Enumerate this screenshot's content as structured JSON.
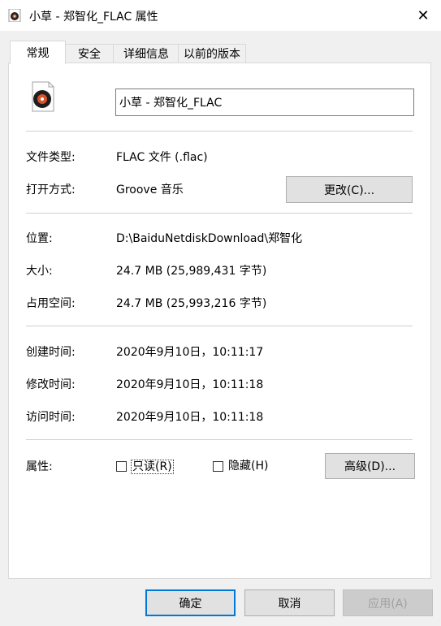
{
  "window": {
    "title": "小草 - 郑智化_FLAC 属性",
    "close_glyph": "✕"
  },
  "tabs": [
    {
      "label": "常规"
    },
    {
      "label": "安全"
    },
    {
      "label": "详细信息"
    },
    {
      "label": "以前的版本"
    }
  ],
  "general": {
    "file_name": "小草 - 郑智化_FLAC",
    "type_label": "文件类型:",
    "type_value": "FLAC 文件 (.flac)",
    "opens_label": "打开方式:",
    "opens_value": "Groove 音乐",
    "change_button": "更改(C)...",
    "location_label": "位置:",
    "location_value": "D:\\BaiduNetdiskDownload\\郑智化",
    "size_label": "大小:",
    "size_value": "24.7 MB (25,989,431 字节)",
    "disk_label": "占用空间:",
    "disk_value": "24.7 MB (25,993,216 字节)",
    "created_label": "创建时间:",
    "created_value": "2020年9月10日，10:11:17",
    "modified_label": "修改时间:",
    "modified_value": "2020年9月10日，10:11:18",
    "accessed_label": "访问时间:",
    "accessed_value": "2020年9月10日，10:11:18",
    "attributes_label": "属性:",
    "readonly_label": "只读(R)",
    "hidden_label": "隐藏(H)",
    "advanced_button": "高级(D)..."
  },
  "footer": {
    "ok": "确定",
    "cancel": "取消",
    "apply": "应用(A)"
  },
  "icons": {
    "title_icon": "flac-file-icon",
    "file_icon": "music-disc-icon"
  },
  "colors": {
    "accent": "#0078d7"
  }
}
